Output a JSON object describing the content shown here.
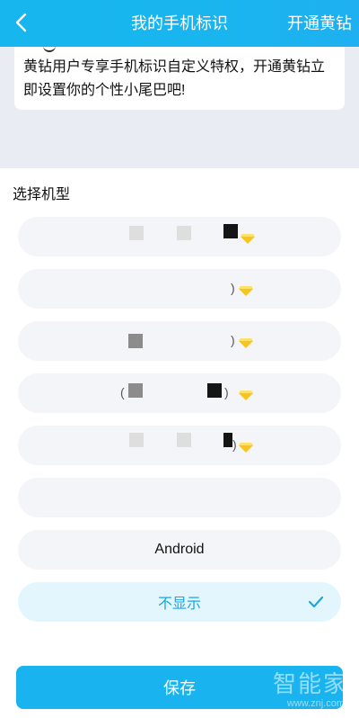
{
  "header": {
    "title": "我的手机标识",
    "action": "开通黄钻"
  },
  "notice": {
    "text": "黄钻用户专享手机标识自定义特权，开通黄钻立即设置你的个性小尾巴吧!"
  },
  "section": {
    "label": "选择机型"
  },
  "options": [
    {
      "label": ""
    },
    {
      "label": ""
    },
    {
      "label": ""
    },
    {
      "label": ""
    },
    {
      "label": ""
    },
    {
      "label": ""
    },
    {
      "label": "Android"
    },
    {
      "label": "不显示",
      "selected": true
    }
  ],
  "footer": {
    "save_label": "保存"
  },
  "watermark": {
    "text": "智能家",
    "url": "www.znj.com"
  },
  "colors": {
    "accent": "#19b4ef",
    "selected_bg": "#e3f6fd",
    "gray_bg": "#e9ecf2"
  }
}
